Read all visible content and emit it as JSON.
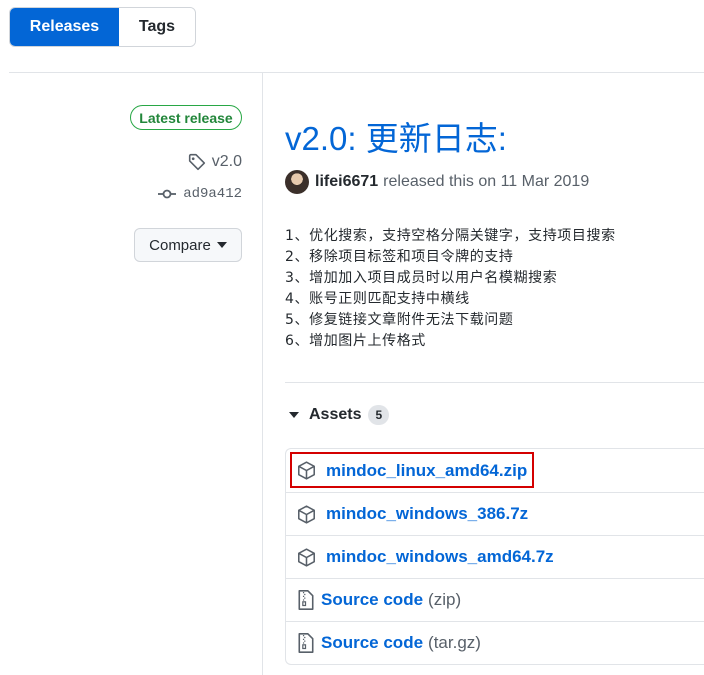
{
  "tabs": [
    {
      "label": "Releases",
      "active": true
    },
    {
      "label": "Tags",
      "active": false
    }
  ],
  "sidebar": {
    "badge": "Latest release",
    "tag": "v2.0",
    "commit": "ad9a412",
    "compare_label": "Compare"
  },
  "release": {
    "title": "v2.0: 更新日志:",
    "author": "lifei6671",
    "released_text": "released this on 11 Mar 2019",
    "notes": [
      "1、优化搜索，支持空格分隔关键字，支持项目搜索",
      "2、移除项目标签和项目令牌的支持",
      "3、增加加入项目成员时以用户名模糊搜索",
      "4、账号正则匹配支持中横线",
      "5、修复链接文章附件无法下载问题",
      "6、增加图片上传格式"
    ]
  },
  "assets": {
    "heading": "Assets",
    "count": "5",
    "files": [
      {
        "name": "mindoc_linux_amd64.zip",
        "icon": "package-icon",
        "highlighted": true
      },
      {
        "name": "mindoc_windows_386.7z",
        "icon": "package-icon"
      },
      {
        "name": "mindoc_windows_amd64.7z",
        "icon": "package-icon"
      }
    ],
    "source": [
      {
        "label": "Source code",
        "format": "(zip)",
        "icon": "file-zip-icon"
      },
      {
        "label": "Source code",
        "format": "(tar.gz)",
        "icon": "file-zip-icon"
      }
    ]
  },
  "colors": {
    "accent": "#0366d6",
    "latest_badge": "#28a745",
    "highlight_box": "#d40000"
  }
}
